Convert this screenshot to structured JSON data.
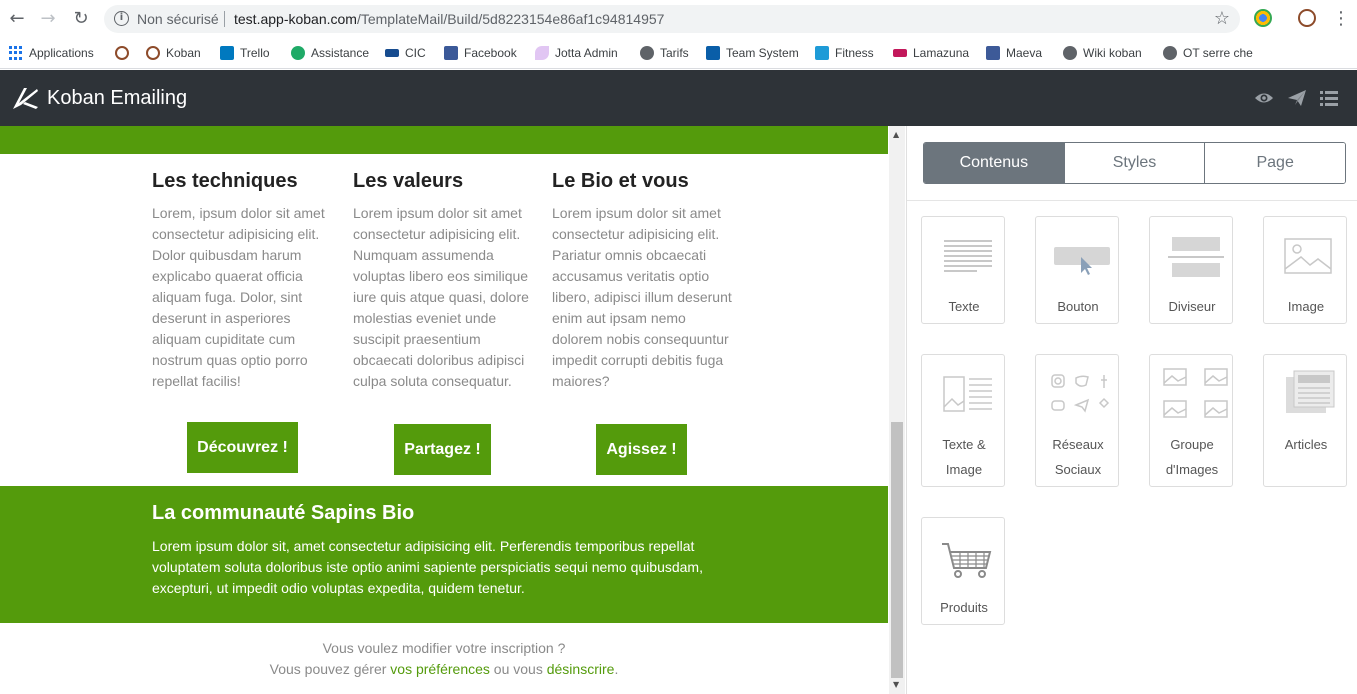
{
  "browser": {
    "back_icon": "arrow-left-icon",
    "forward_icon": "arrow-right-icon",
    "reload_icon": "reload-icon",
    "security_label": "Non sécurisé",
    "url_host": "test.app-koban.com",
    "url_path": "/TemplateMail/Build/5d8223154e86af1c94814957",
    "bookmarks": [
      {
        "label": "Applications"
      },
      {
        "label": ""
      },
      {
        "label": "Koban"
      },
      {
        "label": "Trello"
      },
      {
        "label": "Assistance"
      },
      {
        "label": "CIC"
      },
      {
        "label": "Facebook"
      },
      {
        "label": "Jotta Admin"
      },
      {
        "label": "Tarifs"
      },
      {
        "label": "Team System"
      },
      {
        "label": "Fitness"
      },
      {
        "label": "Lamazuna"
      },
      {
        "label": "Maeva"
      },
      {
        "label": "Wiki koban"
      },
      {
        "label": "OT serre che"
      }
    ]
  },
  "app": {
    "title": "Koban Emailing",
    "header_icons": [
      "eye-icon",
      "send-icon",
      "list-icon"
    ]
  },
  "email": {
    "columns": [
      {
        "title": "Les techniques",
        "body": "Lorem, ipsum dolor sit amet consectetur adipisicing elit. Dolor quibusdam harum explicabo quaerat officia aliquam fuga. Dolor, sint deserunt in asperiores aliquam cupiditate cum nostrum quas optio porro repellat facilis!",
        "cta": "Découvrez !"
      },
      {
        "title": "Les valeurs",
        "body": "Lorem ipsum dolor sit amet consectetur adipisicing elit. Numquam assumenda voluptas libero eos similique iure quis atque quasi, dolore molestias eveniet unde suscipit praesentium obcaecati doloribus adipisci culpa soluta consequatur.",
        "cta": "Partagez !"
      },
      {
        "title": "Le Bio et vous",
        "body": "Lorem ipsum dolor sit amet consectetur adipisicing elit. Pariatur omnis obcaecati accusamus veritatis optio libero, adipisci illum deserunt enim aut ipsam nemo dolorem nobis consequuntur impedit corrupti debitis fuga maiores?",
        "cta": "Agissez !"
      }
    ],
    "community": {
      "title": "La communauté Sapins Bio",
      "body": "Lorem ipsum dolor sit, amet consectetur adipisicing elit. Perferendis temporibus repellat voluptatem soluta doloribus iste optio animi sapiente perspiciatis sequi nemo quibusdam, excepturi, ut impedit odio voluptas expedita, quidem tenetur."
    },
    "footer": {
      "line1": "Vous voulez modifier votre inscription ?",
      "line2_prefix": "Vous pouvez gérer ",
      "prefs_link": "vos préférences",
      "line2_middle": " ou vous ",
      "unsub_link": "désinscrire",
      "line2_suffix": "."
    },
    "brand_green": "#549b0c"
  },
  "panel": {
    "tabs": [
      {
        "label": "Contenus",
        "active": true
      },
      {
        "label": "Styles",
        "active": false
      },
      {
        "label": "Page",
        "active": false
      }
    ],
    "blocks": [
      {
        "line1": "Texte",
        "line2": "",
        "icon": "text-block-icon"
      },
      {
        "line1": "Bouton",
        "line2": "",
        "icon": "button-block-icon"
      },
      {
        "line1": "Diviseur",
        "line2": "",
        "icon": "divider-block-icon"
      },
      {
        "line1": "Image",
        "line2": "",
        "icon": "image-block-icon"
      },
      {
        "line1": "Texte &",
        "line2": "Image",
        "icon": "text-image-block-icon"
      },
      {
        "line1": "Réseaux",
        "line2": "Sociaux",
        "icon": "social-block-icon"
      },
      {
        "line1": "Groupe",
        "line2": "d'Images",
        "icon": "image-group-block-icon"
      },
      {
        "line1": "Articles",
        "line2": "",
        "icon": "articles-block-icon"
      },
      {
        "line1": "Produits",
        "line2": "",
        "icon": "cart-block-icon"
      }
    ]
  }
}
